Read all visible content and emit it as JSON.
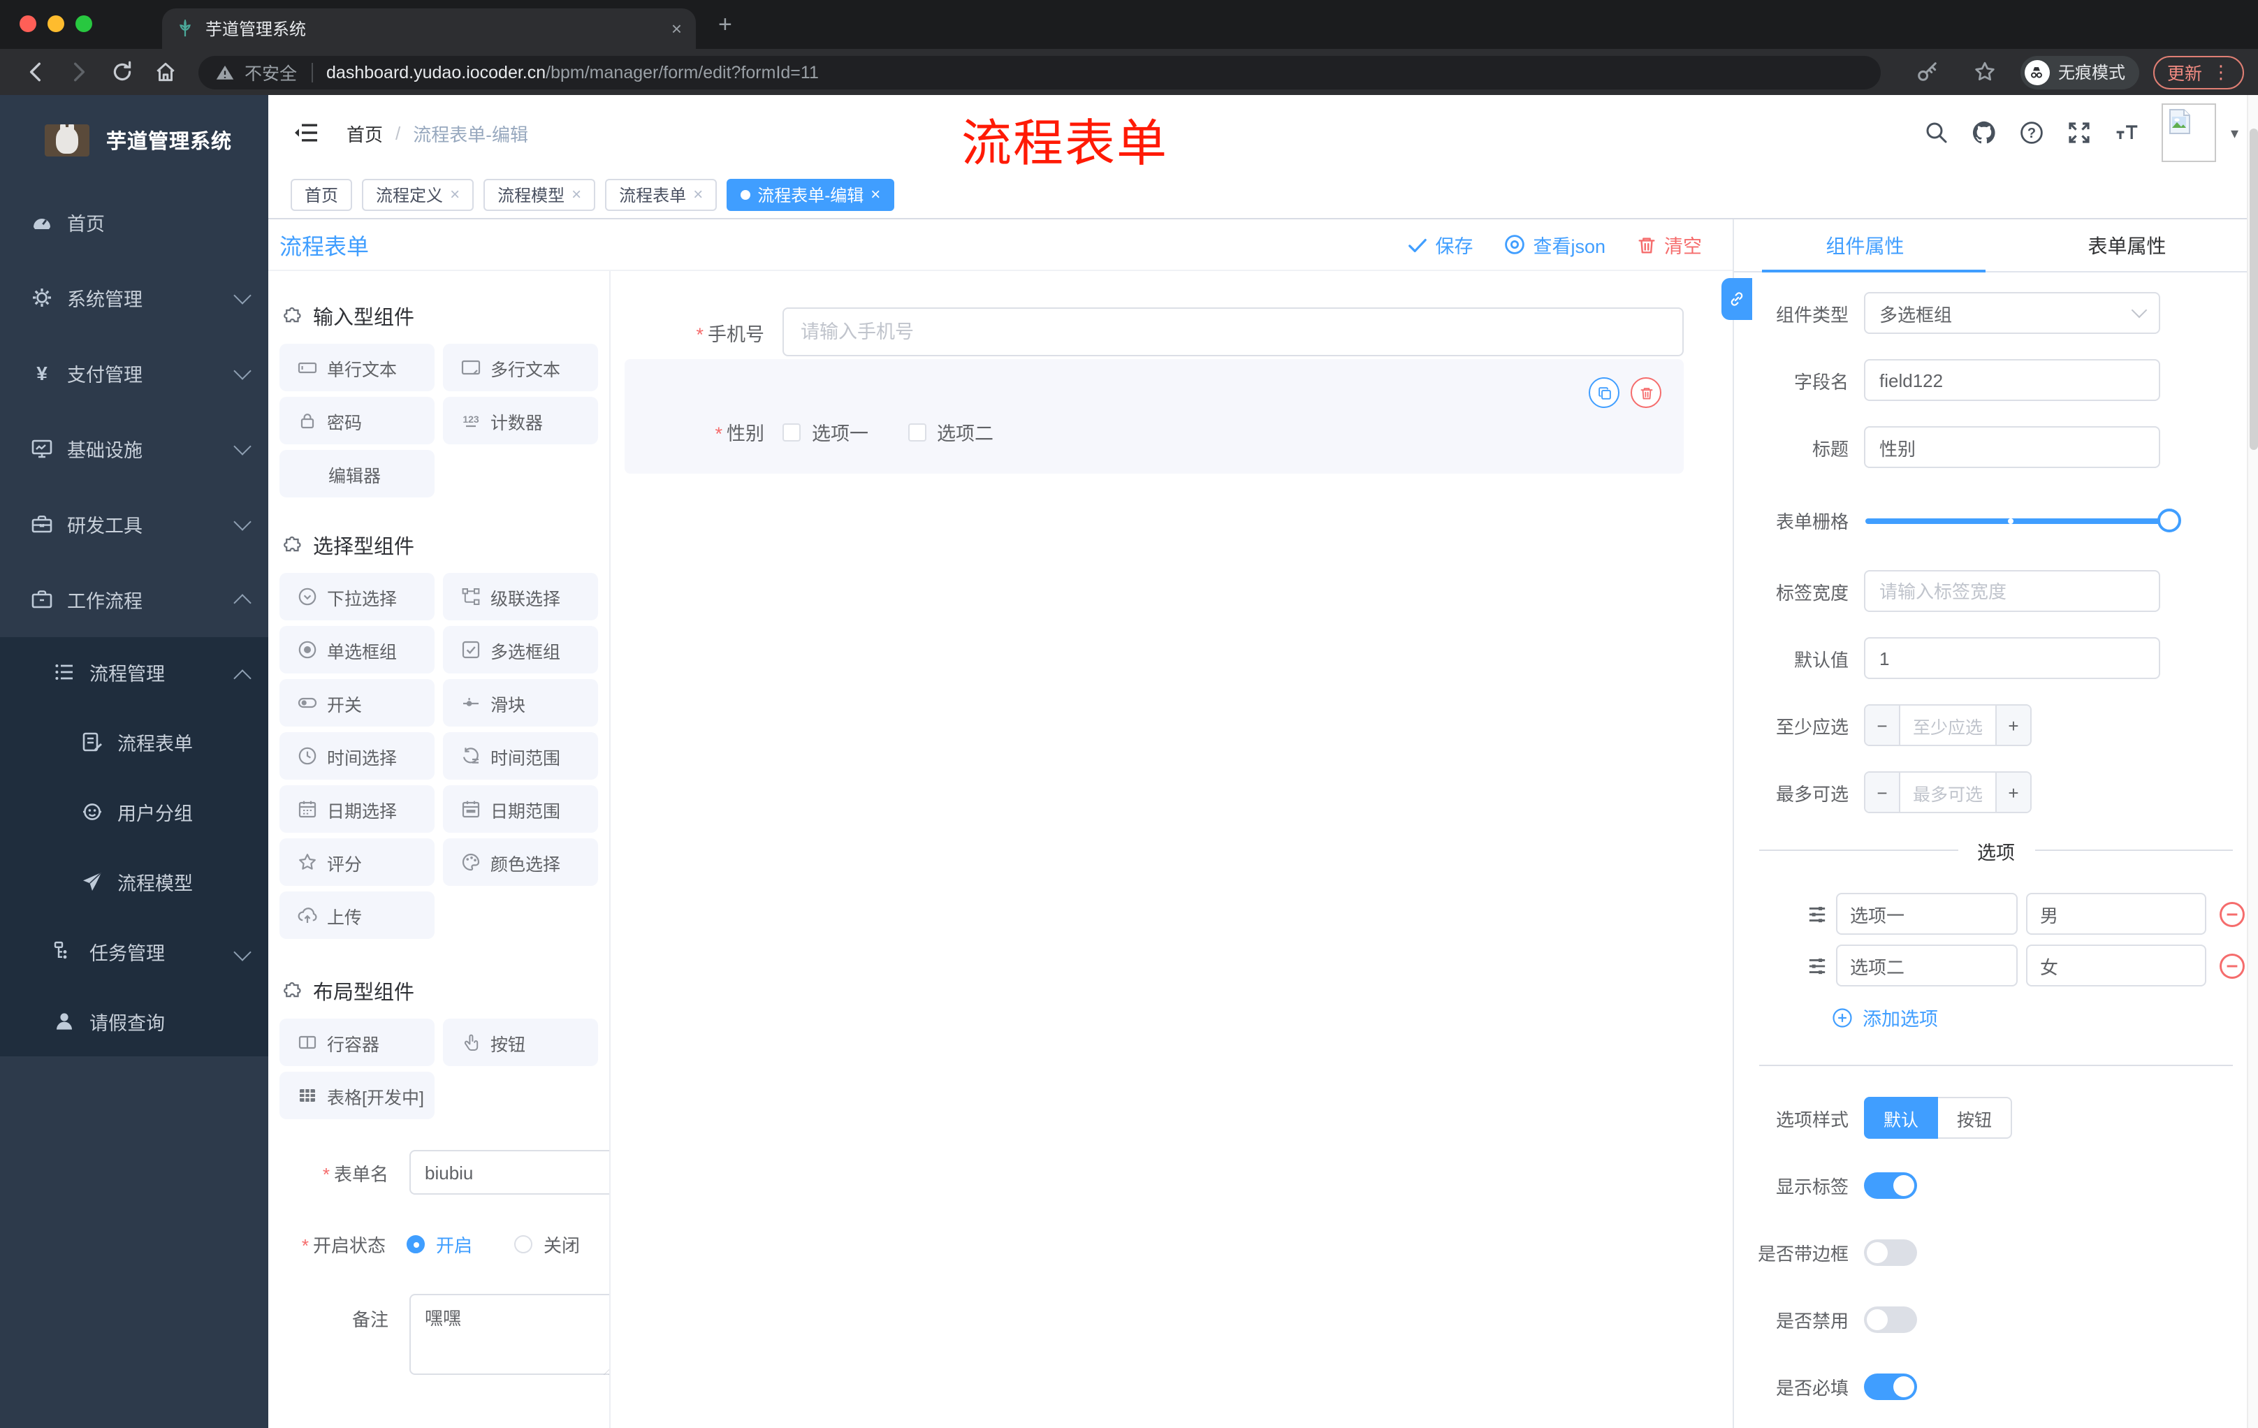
{
  "browser": {
    "tab_title": "芋道管理系统",
    "security_label": "不安全",
    "url_host": "dashboard.yudao.iocoder.cn",
    "url_path": "/bpm/manager/form/edit?formId=11",
    "incognito_label": "无痕模式",
    "update_label": "更新"
  },
  "glyphs": {
    "close": "×",
    "kebab": "⋮",
    "caret_down": "▾",
    "active_dot": "●",
    "plus": "+",
    "minus": "−",
    "slash": "/",
    "question": "?",
    "yen": "¥",
    "counter": "123",
    "font_size": "tT",
    "newtab": "+"
  },
  "sidebar": {
    "app_title": "芋道管理系统",
    "items": [
      {
        "label": "首页"
      },
      {
        "label": "系统管理"
      },
      {
        "label": "支付管理"
      },
      {
        "label": "基础设施"
      },
      {
        "label": "研发工具"
      },
      {
        "label": "工作流程"
      }
    ],
    "submenu": [
      {
        "label": "流程管理"
      },
      {
        "label": "流程表单"
      },
      {
        "label": "用户分组"
      },
      {
        "label": "流程模型"
      },
      {
        "label": "任务管理"
      },
      {
        "label": "请假查询"
      }
    ]
  },
  "header": {
    "breadcrumb_home": "首页",
    "breadcrumb_current": "流程表单-编辑",
    "annotation": "流程表单"
  },
  "tabsbar": {
    "tabs": [
      {
        "label": "首页"
      },
      {
        "label": "流程定义"
      },
      {
        "label": "流程模型"
      },
      {
        "label": "流程表单"
      },
      {
        "label": "流程表单-编辑"
      }
    ]
  },
  "toolbar": {
    "title": "流程表单",
    "save_label": "保存",
    "view_json_label": "查看json",
    "clear_label": "清空"
  },
  "components_panel": {
    "sections": [
      {
        "title": "输入型组件",
        "items": [
          "单行文本",
          "多行文本",
          "密码",
          "计数器",
          "编辑器"
        ]
      },
      {
        "title": "选择型组件",
        "items": [
          "下拉选择",
          "级联选择",
          "单选框组",
          "多选框组",
          "开关",
          "滑块",
          "时间选择",
          "时间范围",
          "日期选择",
          "日期范围",
          "评分",
          "颜色选择",
          "上传"
        ]
      },
      {
        "title": "布局型组件",
        "items": [
          "行容器",
          "按钮",
          "表格[开发中]"
        ]
      }
    ],
    "form": {
      "name_label": "表单名",
      "name_value": "biubiu",
      "status_label": "开启状态",
      "status_on": "开启",
      "status_off": "关闭",
      "remark_label": "备注",
      "remark_value": "嘿嘿"
    }
  },
  "canvas": {
    "phone_label": "手机号",
    "phone_placeholder": "请输入手机号",
    "gender_label": "性别",
    "gender_option1": "选项一",
    "gender_option2": "选项二"
  },
  "props": {
    "tab_component": "组件属性",
    "tab_form": "表单属性",
    "type_label": "组件类型",
    "type_value": "多选框组",
    "field_label": "字段名",
    "field_value": "field122",
    "title_label": "标题",
    "title_value": "性别",
    "grid_label": "表单栅格",
    "label_width_label": "标签宽度",
    "label_width_placeholder": "请输入标签宽度",
    "default_label": "默认值",
    "default_value": "1",
    "min_label": "至少应选",
    "min_placeholder": "至少应选",
    "max_label": "最多可选",
    "max_placeholder": "最多可选",
    "options_title": "选项",
    "options": [
      {
        "label": "选项一",
        "value": "男"
      },
      {
        "label": "选项二",
        "value": "女"
      }
    ],
    "add_option_label": "添加选项",
    "style_label": "选项样式",
    "style_default": "默认",
    "style_button": "按钮",
    "toggle_show_label": "显示标签",
    "toggle_border_label": "是否带边框",
    "toggle_disabled_label": "是否禁用",
    "toggle_required_label": "是否必填"
  },
  "colors": {
    "accent": "#409eff",
    "danger": "#f56c6c",
    "annotation_red": "#ff1a05",
    "sidebar_bg": "#2d3a4b",
    "sidebar_submenu_bg": "#1f2d3d",
    "chip_bg": "#f4f6fc",
    "selected_block_bg": "#f6f7fc",
    "active_tab_bg": "#409eff"
  }
}
